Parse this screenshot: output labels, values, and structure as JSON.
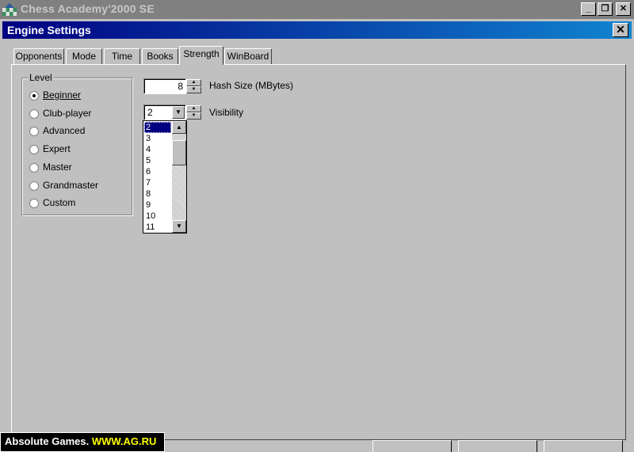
{
  "app": {
    "title": "Chess Academy'2000 SE"
  },
  "dialog": {
    "title": "Engine Settings",
    "close_label": "✕"
  },
  "tabs": [
    {
      "label": "Opponents",
      "active": false
    },
    {
      "label": "Mode",
      "active": false
    },
    {
      "label": "Time",
      "active": false
    },
    {
      "label": "Books",
      "active": false
    },
    {
      "label": "Strength",
      "active": true
    },
    {
      "label": "WinBoard",
      "active": false
    }
  ],
  "level": {
    "legend": "Level",
    "selected": "Beginner",
    "options": [
      {
        "label": "Beginner",
        "accel": "B"
      },
      {
        "label": "Club-player",
        "accel": "C"
      },
      {
        "label": "Advanced",
        "accel": "A"
      },
      {
        "label": "Expert",
        "accel": "E"
      },
      {
        "label": "Master",
        "accel": "M"
      },
      {
        "label": "Grandmaster",
        "accel": "G"
      },
      {
        "label": "Custom",
        "accel": "C"
      }
    ]
  },
  "hash": {
    "value": "8",
    "label": "Hash Size (MBytes)"
  },
  "visibility": {
    "value": "2",
    "label": "Visibility",
    "options": [
      "2",
      "3",
      "4",
      "5",
      "6",
      "7",
      "8",
      "9",
      "10",
      "11"
    ],
    "selected": "2"
  },
  "watermark": {
    "brand": "Absolute Games.",
    "url": "WWW.AG.RU"
  },
  "colors": {
    "dialog_title_start": "#000080",
    "dialog_title_end": "#1084d0",
    "face": "#c0c0c0"
  },
  "icons": [
    "chess-app-icon",
    "minimize-icon",
    "restore-icon",
    "close-icon",
    "spin-up-icon",
    "spin-down-icon",
    "dropdown-arrow-icon",
    "scroll-up-icon",
    "scroll-down-icon"
  ]
}
